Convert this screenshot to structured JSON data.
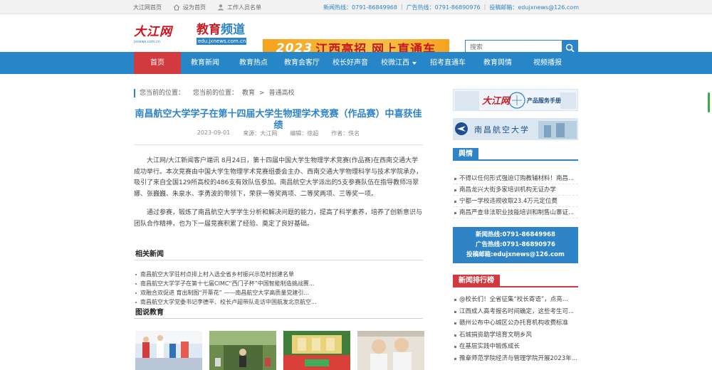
{
  "topbar": {
    "links": [
      "大江网首页",
      "设为首页",
      "工作人员名单"
    ],
    "hotline": "新闻热线：0791-86849968",
    "ad_hotline": "广告热线：0791-86890976",
    "email": "投稿邮箱：edujxnews@126.com",
    "sep": "|"
  },
  "header": {
    "logo_main": "大江网",
    "logo_main_sub": "jxnews.com.cn",
    "logo_edu_a": "教育",
    "logo_edu_b": "频道",
    "logo_edu_url": "edu.jxnews.com.cn",
    "banner_year": "2023",
    "banner_text": "江西高招 网上直通车",
    "search_placeholder": "搜索"
  },
  "nav": {
    "items": [
      "首页",
      "教育新闻",
      "教育热点",
      "教育会客厅",
      "校长好声音",
      "校微江西",
      "招考直通车",
      "教育舆情",
      "视频播报"
    ]
  },
  "breadcrumb": {
    "label": "您当前的位置：",
    "parts": [
      "您当前的位置：",
      "教育",
      ">",
      "普通高校"
    ]
  },
  "article": {
    "title": "南昌航空大学学子在第十四届大学生物理学术竞赛（作品赛）中喜获佳绩",
    "date": "2023-09-01",
    "source": "来源：大江网",
    "editor": "编辑：徐超",
    "author": "作者：佚名",
    "paragraphs": [
      "大江网/大江新闻客户端讯 8月24日，第十四届中国大学生物理学术竞赛(作品赛)在西南交通大学成功举行。本次竞赛由中国大学生物理学术竞赛组委会主办、西南交通大学物理科学与技术学院承办，吸引了来自全国129所高校的486支有效队伍参加。南昌航空大学派出的5支参赛队伍在指导教师冯翠娜、张巍巍、朱泉水、李勇波的带领下，荣获一等奖两项、二等奖两项、三等奖一项。",
      "通过参赛，锻炼了南昌航空大学学生分析和解决问题的能力，提高了科学素养，培养了创新意识与团队合作精神，也为下一届竞赛积累了经验、奠定了良好基础。"
    ]
  },
  "related": {
    "heading": "相关新闻",
    "items": [
      "南昌航空大学驻村点排上村入选全省乡村振兴示范村创建名单",
      "南昌航空大学学子在第十七届CIMC“西门子杯”中国智能制造挑战赛...",
      "双融合双促进 育出制图“开蒂花” ——南昌航空大学高质量党建引...",
      "南昌航空大学党委书记李德平、校长卢超带队走访中国航发北京航空..."
    ]
  },
  "photo_edu": {
    "heading": "图说教育"
  },
  "sidebar": {
    "ad1_text": "大江网",
    "ad1_sub": "产品服务手册",
    "ad2_text": "南昌航空大学",
    "yuqing_tab": "舆情",
    "yuqing_items": [
      "不得以任何形式强迫订购教辅材料！南昌...",
      "南昌龙兴大街多家培训机构无证办学",
      "宁都一学校违规收取23.4万元定位费",
      "南昌严查非法职业技能培训和制售山寨证..."
    ],
    "hotline": "新闻热线:0791-86849968",
    "adline": "广告热线:0791-86890976",
    "email": "投稿邮箱:edujxnews@126.com",
    "rank_tab": "新闻排行榜",
    "rank_items": [
      "@校长们！全省征集“校长寄语”，点亮...",
      "江西成人高考报名时间确定，这些考生可...",
      "赣州公布中心城区公办托育机构收费标准",
      "石城捐资助学培育文明乡风",
      "在基层实践中锻炼成长",
      "豫章师范学院经济与管理学院开展2023年..."
    ]
  },
  "colors": {
    "brand_blue": "#2686c7",
    "active_red": "#d13a3f",
    "banner_orange": "#f6a21c"
  }
}
